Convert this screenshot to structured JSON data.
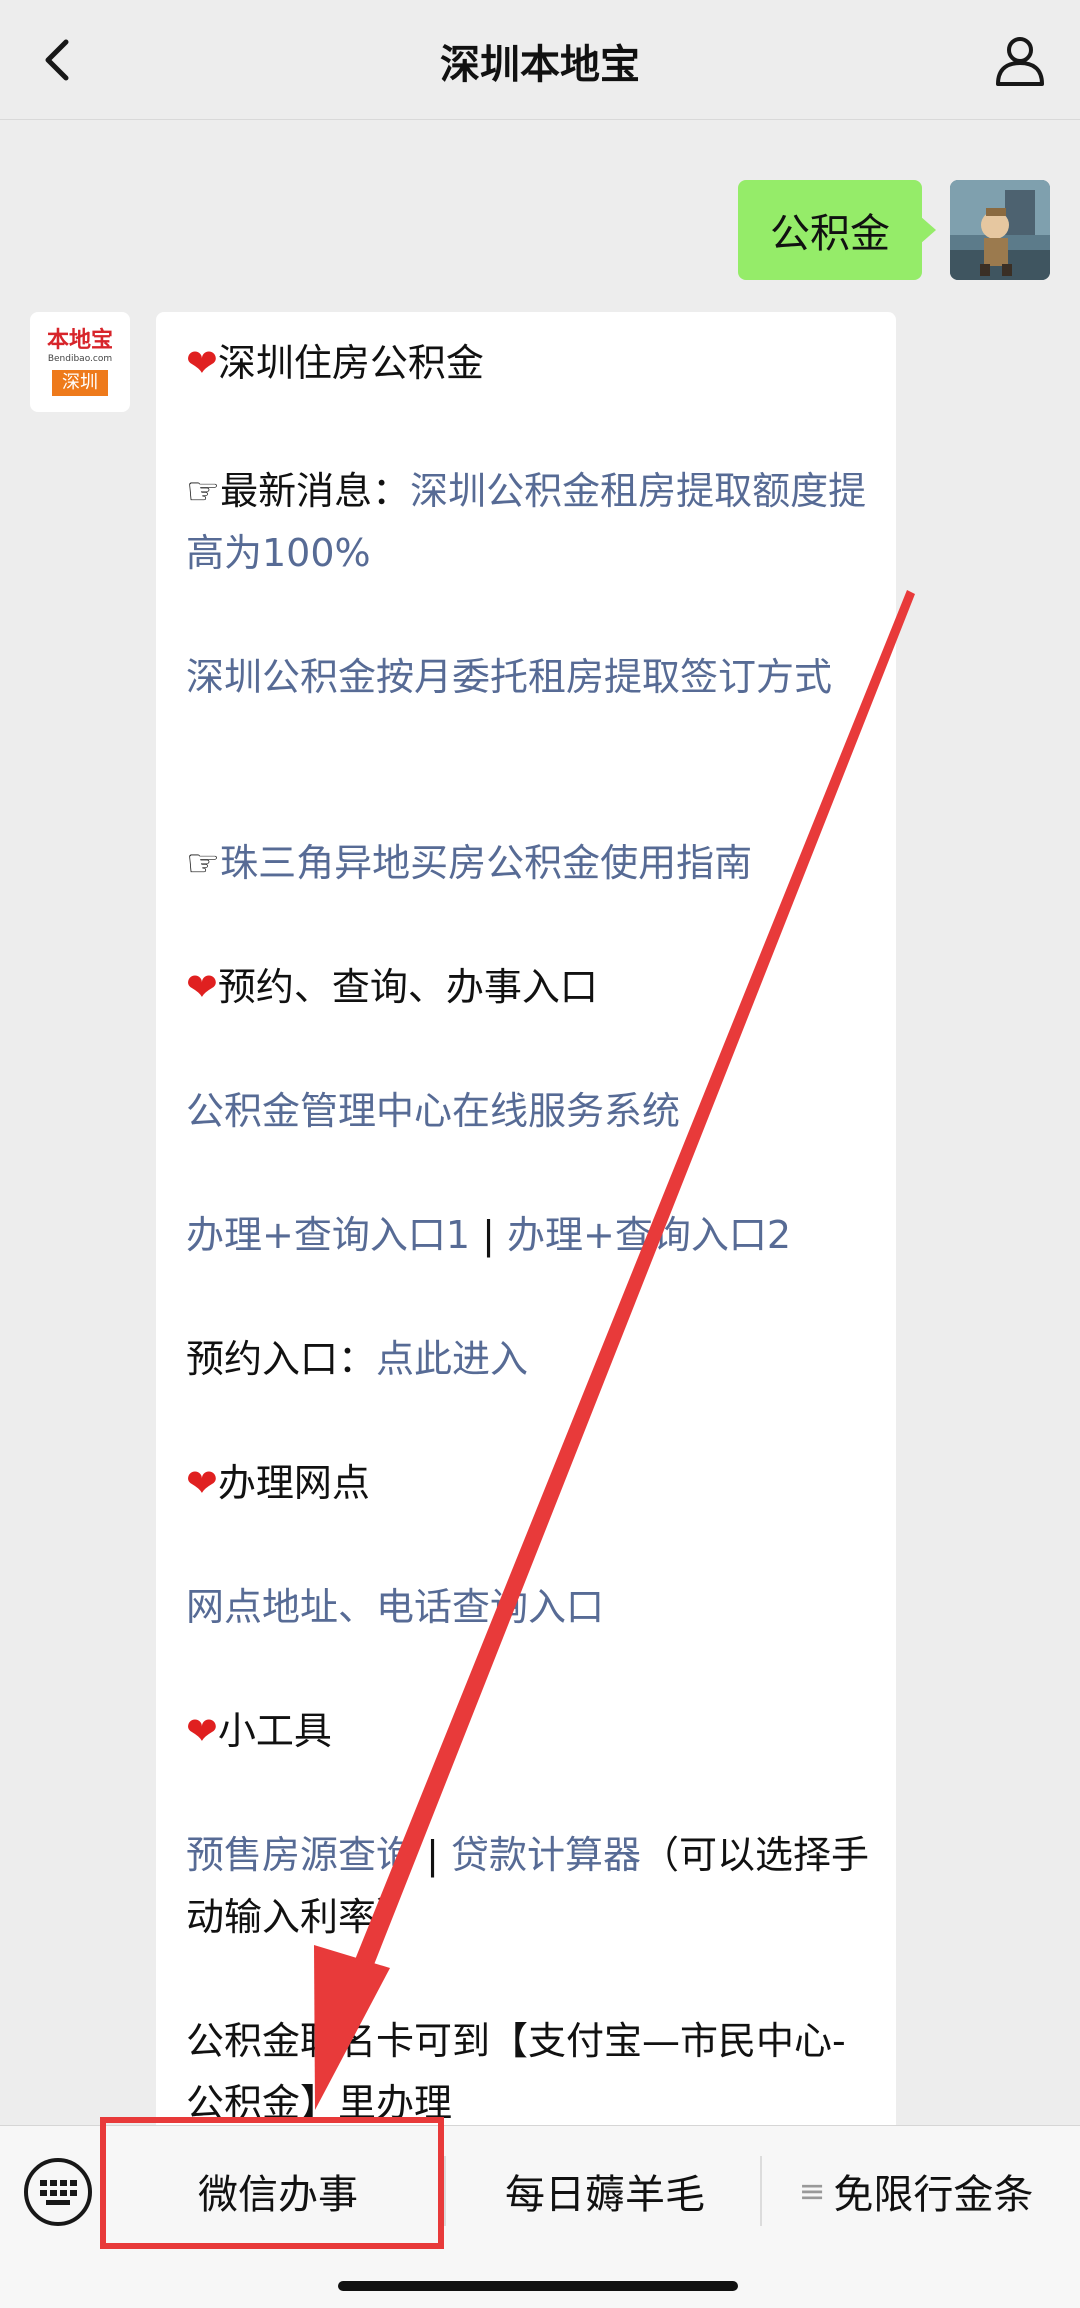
{
  "header": {
    "title": "深圳本地宝"
  },
  "chat": {
    "outgoing_text": "公积金",
    "bot_avatar": {
      "brand": "本地宝",
      "domain": "Bendibao.com",
      "city": "深圳"
    },
    "lines": [
      {
        "type": "heading",
        "text": "深圳住房公积金"
      },
      {
        "type": "mixed",
        "prefix": "☞最新消息：",
        "link": "深圳公积金租房提取额度提高为100%"
      },
      {
        "type": "link",
        "text": "深圳公积金按月委托租房提取签订方式"
      },
      {
        "type": "link",
        "prefix": "☞",
        "text": "珠三角异地买房公积金使用指南"
      },
      {
        "type": "heading",
        "text": "预约、查询、办事入口"
      },
      {
        "type": "link",
        "text": "公积金管理中心在线服务系统"
      },
      {
        "type": "links2",
        "a": "办理+查询入口1",
        "sep": " | ",
        "b": "办理+查询入口2"
      },
      {
        "type": "mixed",
        "prefix": "预约入口：",
        "link": "点此进入"
      },
      {
        "type": "heading",
        "text": "办理网点"
      },
      {
        "type": "link",
        "text": "网点地址、电话查询入口"
      },
      {
        "type": "heading",
        "text": "小工具"
      },
      {
        "type": "tools",
        "a": "预售房源查询",
        "sep": " | ",
        "b": "贷款计算器",
        "suffix": "（可以选择手动输入利率）"
      },
      {
        "type": "plain",
        "text": "公积金联名卡可到【支付宝—市民中心-公积金】里办理"
      }
    ]
  },
  "bottom_menu": {
    "items": [
      "微信办事",
      "每日薅羊毛",
      "免限行金条"
    ],
    "third_prefix": "≡"
  },
  "colors": {
    "link": "#576b95",
    "bubble_out": "#95ec69",
    "annotation": "#e83a3a"
  }
}
